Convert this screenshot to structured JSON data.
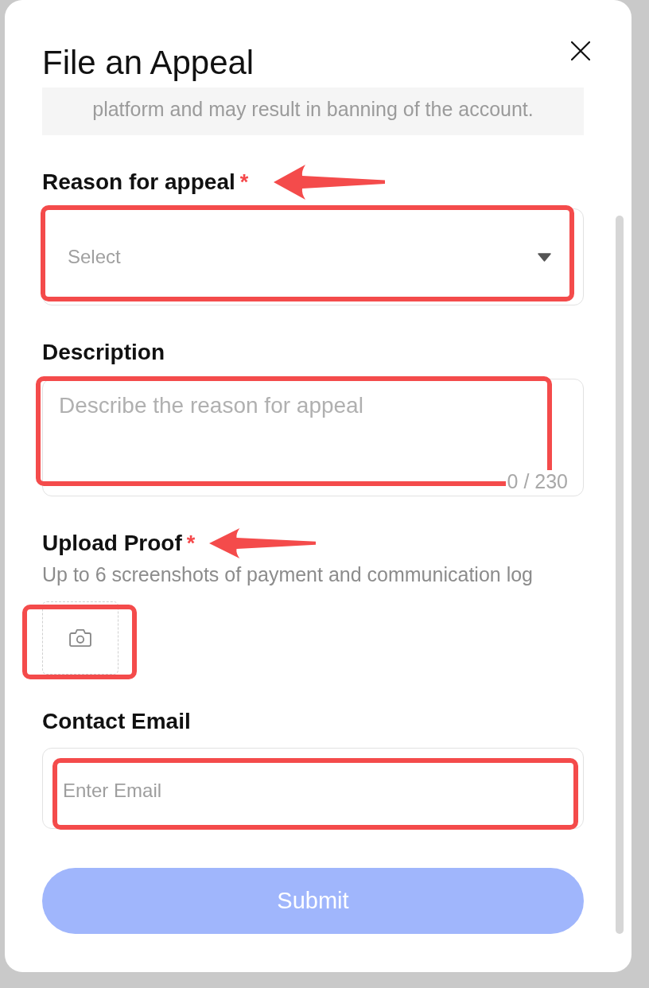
{
  "dialog": {
    "title": "File an Appeal"
  },
  "notice": {
    "text": "platform and may result in banning of the account."
  },
  "fields": [
    {
      "kind": "select",
      "label": "Reason for appeal",
      "required_mark": "*",
      "placeholder": "Select",
      "arrow": true,
      "highlighted": true
    },
    {
      "kind": "textarea",
      "label": "Description",
      "placeholder": "Describe the reason for appeal",
      "counter": "0 / 230",
      "arrow": false,
      "highlighted": true
    },
    {
      "kind": "upload",
      "label": "Upload Proof",
      "required_mark": "*",
      "hint": "Up to 6 screenshots of payment and communication log",
      "arrow": true,
      "highlighted": true
    },
    {
      "kind": "input",
      "label": "Contact Email",
      "placeholder": "Enter Email",
      "arrow": false,
      "highlighted": true
    }
  ],
  "submit": {
    "label": "Submit",
    "disabled": true
  }
}
